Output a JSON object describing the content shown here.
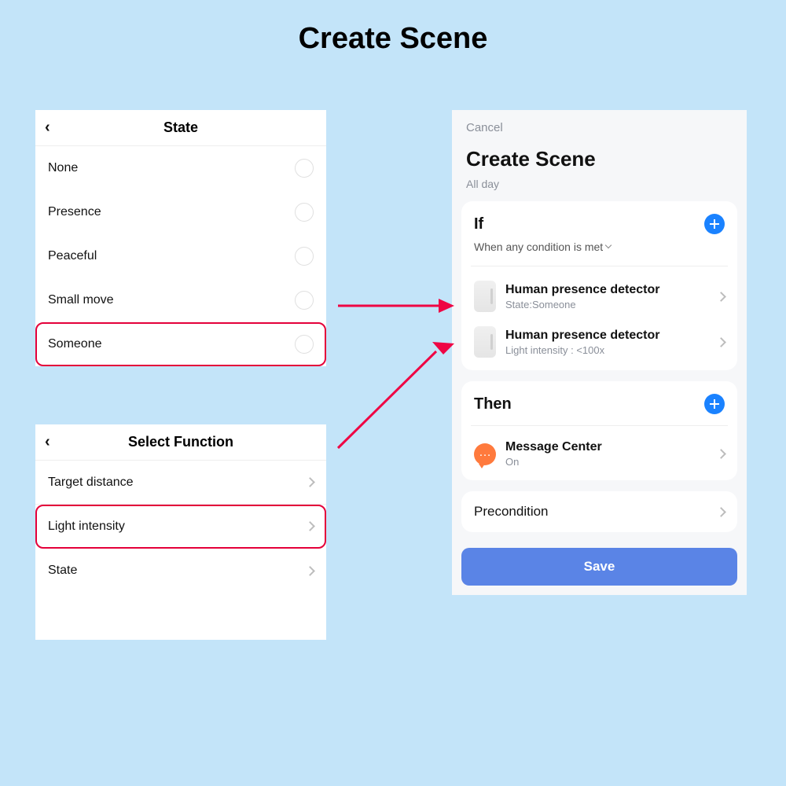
{
  "page_title": "Create Scene",
  "state_panel": {
    "title": "State",
    "options": [
      "None",
      "Presence",
      "Peaceful",
      "Small move",
      "Someone"
    ],
    "highlighted": "Someone"
  },
  "func_panel": {
    "title": "Select Function",
    "options": [
      "Target distance",
      "Light intensity",
      "State"
    ],
    "highlighted": "Light intensity"
  },
  "scene_panel": {
    "cancel": "Cancel",
    "title": "Create Scene",
    "subtitle": "All day",
    "if": {
      "title": "If",
      "condition_mode": "When any condition is met",
      "rules": [
        {
          "name": "Human presence detector",
          "detail": "State:Someone"
        },
        {
          "name": "Human presence detector",
          "detail": "Light intensity : <100x"
        }
      ]
    },
    "then": {
      "title": "Then",
      "actions": [
        {
          "name": "Message Center",
          "detail": "On"
        }
      ]
    },
    "precondition": "Precondition",
    "save": "Save"
  }
}
